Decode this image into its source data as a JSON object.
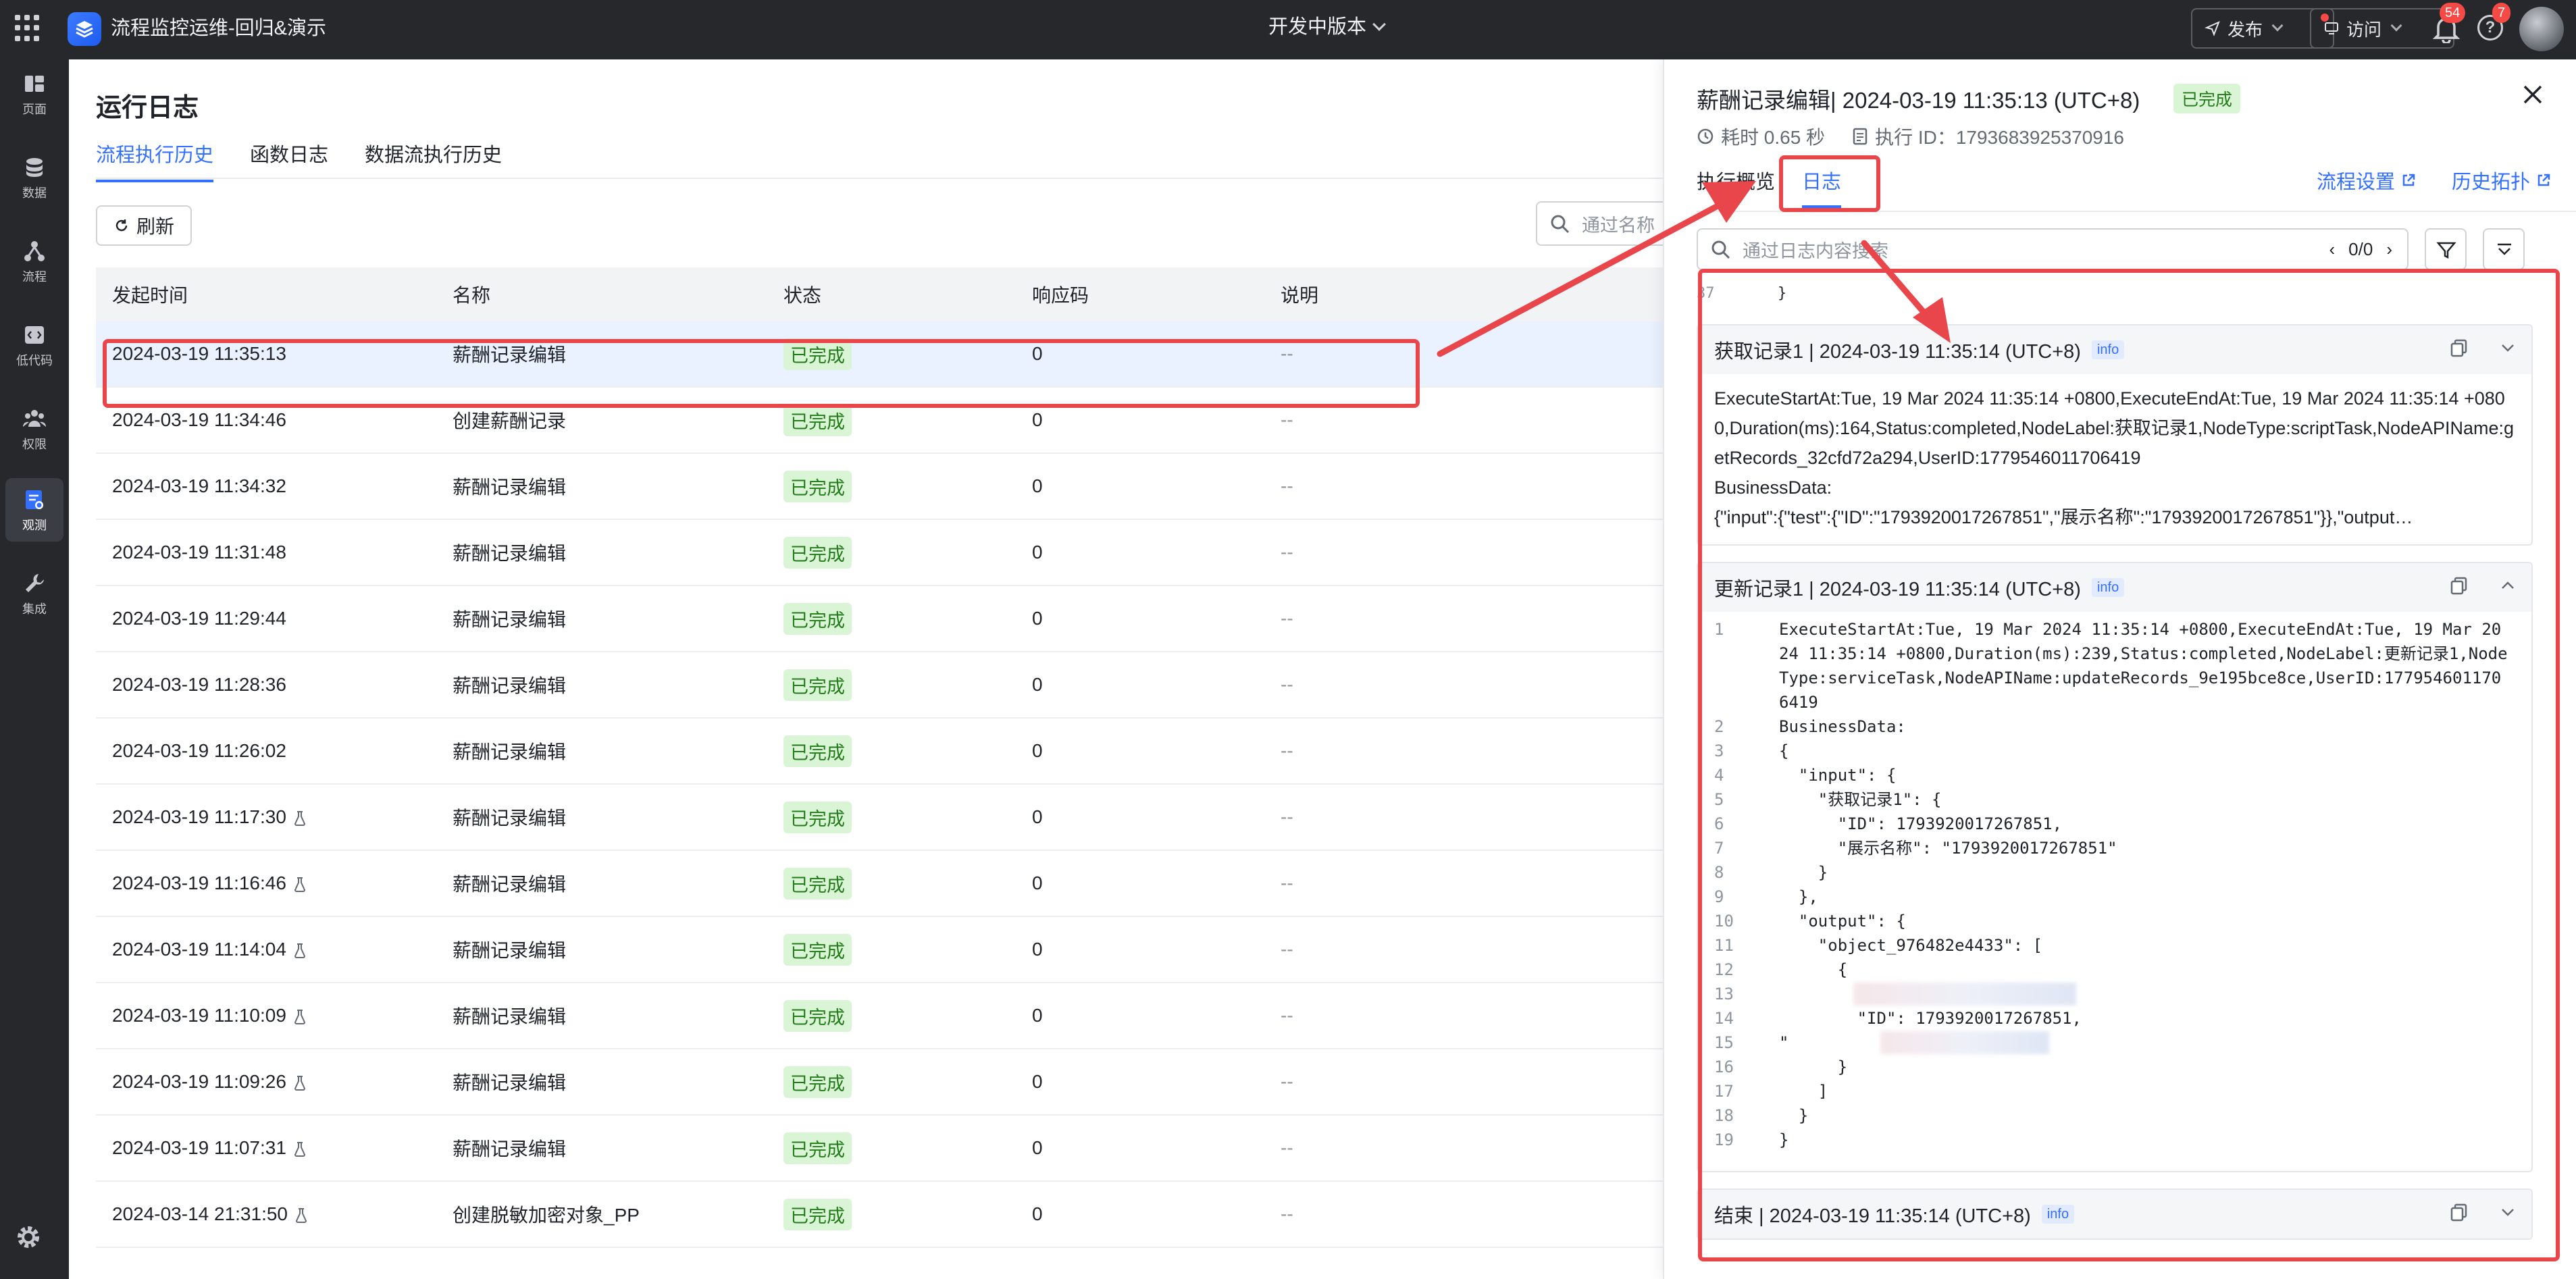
{
  "topbar": {
    "app_title": "流程监控运维-回归&演示",
    "version": "开发中版本",
    "publish_label": "发布",
    "visit_label": "访问",
    "notif_count": "54",
    "help_count": "7"
  },
  "leftnav": {
    "items": [
      {
        "label": "页面",
        "icon": "page-icon"
      },
      {
        "label": "数据",
        "icon": "database-icon"
      },
      {
        "label": "流程",
        "icon": "flow-icon"
      },
      {
        "label": "低代码",
        "icon": "code-icon"
      },
      {
        "label": "权限",
        "icon": "users-icon"
      },
      {
        "label": "观测",
        "icon": "monitor-icon"
      },
      {
        "label": "集成",
        "icon": "wrench-icon"
      }
    ]
  },
  "main": {
    "title": "运行日志",
    "tabs": [
      "流程执行历史",
      "函数日志",
      "数据流执行历史"
    ],
    "refresh_label": "刷新",
    "search_placeholder": "通过名称",
    "columns": [
      "发起时间",
      "名称",
      "状态",
      "响应码",
      "说明"
    ],
    "rows": [
      {
        "time": "2024-03-19 11:35:13",
        "name": "薪酬记录编辑",
        "status": "已完成",
        "code": "0",
        "desc": "--",
        "test": false
      },
      {
        "time": "2024-03-19 11:34:46",
        "name": "创建薪酬记录",
        "status": "已完成",
        "code": "0",
        "desc": "--",
        "test": false
      },
      {
        "time": "2024-03-19 11:34:32",
        "name": "薪酬记录编辑",
        "status": "已完成",
        "code": "0",
        "desc": "--",
        "test": false
      },
      {
        "time": "2024-03-19 11:31:48",
        "name": "薪酬记录编辑",
        "status": "已完成",
        "code": "0",
        "desc": "--",
        "test": false
      },
      {
        "time": "2024-03-19 11:29:44",
        "name": "薪酬记录编辑",
        "status": "已完成",
        "code": "0",
        "desc": "--",
        "test": false
      },
      {
        "time": "2024-03-19 11:28:36",
        "name": "薪酬记录编辑",
        "status": "已完成",
        "code": "0",
        "desc": "--",
        "test": false
      },
      {
        "time": "2024-03-19 11:26:02",
        "name": "薪酬记录编辑",
        "status": "已完成",
        "code": "0",
        "desc": "--",
        "test": false
      },
      {
        "time": "2024-03-19 11:17:30",
        "name": "薪酬记录编辑",
        "status": "已完成",
        "code": "0",
        "desc": "--",
        "test": true
      },
      {
        "time": "2024-03-19 11:16:46",
        "name": "薪酬记录编辑",
        "status": "已完成",
        "code": "0",
        "desc": "--",
        "test": true
      },
      {
        "time": "2024-03-19 11:14:04",
        "name": "薪酬记录编辑",
        "status": "已完成",
        "code": "0",
        "desc": "--",
        "test": true
      },
      {
        "time": "2024-03-19 11:10:09",
        "name": "薪酬记录编辑",
        "status": "已完成",
        "code": "0",
        "desc": "--",
        "test": true
      },
      {
        "time": "2024-03-19 11:09:26",
        "name": "薪酬记录编辑",
        "status": "已完成",
        "code": "0",
        "desc": "--",
        "test": true
      },
      {
        "time": "2024-03-19 11:07:31",
        "name": "薪酬记录编辑",
        "status": "已完成",
        "code": "0",
        "desc": "--",
        "test": true
      },
      {
        "time": "2024-03-14 21:31:50",
        "name": "创建脱敏加密对象_PP",
        "status": "已完成",
        "code": "0",
        "desc": "--",
        "test": true
      }
    ]
  },
  "drawer": {
    "title": "薪酬记录编辑| 2024-03-19 11:35:13 (UTC+8)",
    "status": "已完成",
    "duration": "耗时 0.65 秒",
    "exec_id": "执行 ID：1793683925370916",
    "tabs": [
      "执行概览",
      "日志"
    ],
    "link_settings": "流程设置",
    "link_topology": "历史拓扑",
    "log_search_placeholder": "通过日志内容搜索",
    "log_counter": "0/0",
    "line37_no": "37",
    "line37_text": "}",
    "cards": [
      {
        "title": "获取记录1 | 2024-03-19 11:35:14 (UTC+8)",
        "level": "info",
        "body1": "ExecuteStartAt:Tue, 19 Mar 2024 11:35:14 +0800,ExecuteEndAt:Tue, 19 Mar 2024 11:35:14 +0800,Duration(ms):164,Status:completed,NodeLabel:获取记录1,NodeType:scriptTask,NodeAPIName:getRecords_32cfd72a294,UserID:1779546011706419",
        "body2": "BusinessData:",
        "body3": "{\"input\":{\"test\":{\"ID\":\"1793920017267851\",\"展示名称\":\"1793920017267851\"}},\"output…"
      },
      {
        "title": "更新记录1 | 2024-03-19 11:35:14 (UTC+8)",
        "level": "info"
      },
      {
        "title": "结束 | 2024-03-19 11:35:14 (UTC+8)",
        "level": "info"
      }
    ],
    "code_lines": [
      {
        "n": "1",
        "t": "ExecuteStartAt:Tue, 19 Mar 2024 11:35:14 +0800,ExecuteEndAt:Tue, 19 Mar 2024 11:35:14 +0800,Duration(ms):239,Status:completed,NodeLabel:更新记录1,NodeType:serviceTask,NodeAPIName:updateRecords_9e195bce8ce,UserID:1779546011706419"
      },
      {
        "n": "2",
        "t": "BusinessData:"
      },
      {
        "n": "3",
        "t": "{"
      },
      {
        "n": "4",
        "t": "  \"input\": {"
      },
      {
        "n": "5",
        "t": "    \"获取记录1\": {"
      },
      {
        "n": "6",
        "t": "      \"ID\": 1793920017267851,"
      },
      {
        "n": "7",
        "t": "      \"展示名称\": \"1793920017267851\""
      },
      {
        "n": "8",
        "t": "    }"
      },
      {
        "n": "9",
        "t": "  },"
      },
      {
        "n": "10",
        "t": "  \"output\": {"
      },
      {
        "n": "11",
        "t": "    \"object_976482e4433\": ["
      },
      {
        "n": "12",
        "t": "      {"
      },
      {
        "n": "13",
        "t": ""
      },
      {
        "n": "14",
        "t": "        \"ID\": 1793920017267851,"
      },
      {
        "n": "15",
        "t": "\""
      },
      {
        "n": "16",
        "t": "      }"
      },
      {
        "n": "17",
        "t": "    ]"
      },
      {
        "n": "18",
        "t": "  }"
      },
      {
        "n": "19",
        "t": "}"
      }
    ]
  },
  "colors": {
    "accent": "#3370ff",
    "annotation": "#e8464b",
    "success_bg": "#d9f5d6",
    "success_fg": "#237b19"
  }
}
